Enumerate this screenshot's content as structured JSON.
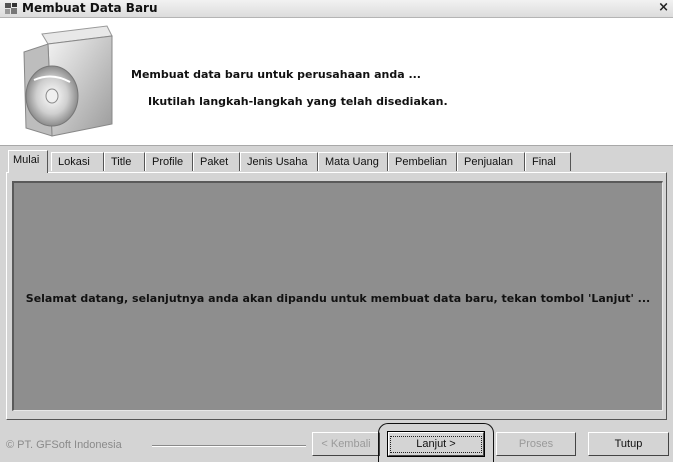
{
  "window": {
    "title": "Membuat Data Baru",
    "close": "×"
  },
  "header": {
    "line1": "Membuat data baru untuk perusahaan anda ...",
    "line2": "Ikutilah langkah-langkah yang telah disediakan."
  },
  "tabs": [
    "Mulai",
    "Lokasi",
    "Title",
    "Profile",
    "Paket",
    "Jenis Usaha",
    "Mata Uang",
    "Pembelian",
    "Penjualan",
    "Final"
  ],
  "panel": {
    "message": "Selamat datang, selanjutnya anda akan dipandu untuk membuat data baru, tekan tombol 'Lanjut' ..."
  },
  "footer": {
    "copyright": "© PT. GFSoft Indonesia",
    "back": "< Kembali",
    "next": "Lanjut >",
    "process": "Proses",
    "close": "Tutup"
  }
}
